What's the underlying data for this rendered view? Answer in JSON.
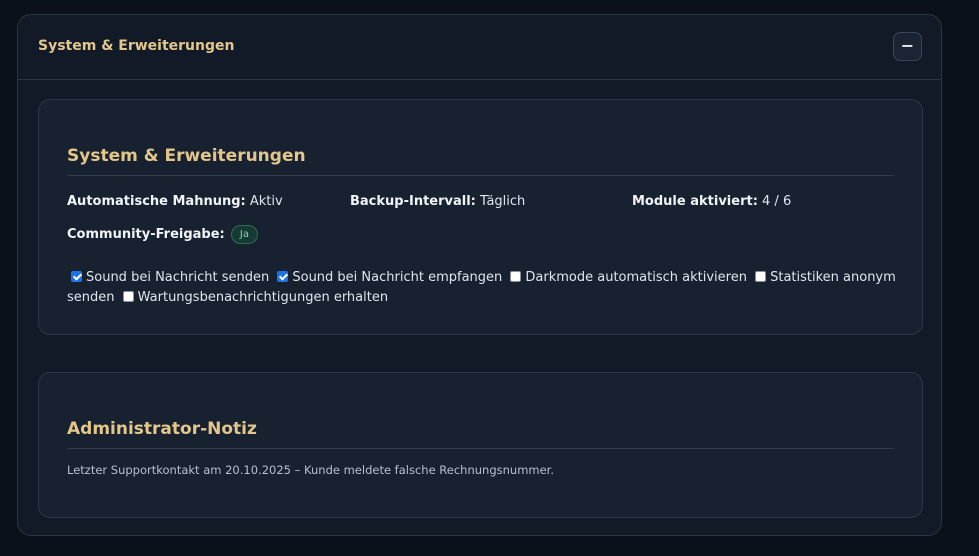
{
  "panel": {
    "title": "System & Erweiterungen",
    "collapse_label": "−"
  },
  "system_card": {
    "title": "System & Erweiterungen",
    "fields": [
      {
        "label": "Automatische Mahnung:",
        "value": "Aktiv"
      },
      {
        "label": "Backup-Intervall:",
        "value": "Täglich"
      },
      {
        "label": "Module aktiviert:",
        "value": "4 / 6"
      }
    ],
    "community": {
      "label": "Community-Freigabe:",
      "badge": "Ja"
    },
    "checkboxes": [
      {
        "label": "Sound bei Nachricht senden",
        "checked": true
      },
      {
        "label": "Sound bei Nachricht empfangen",
        "checked": true
      },
      {
        "label": "Darkmode automatisch aktivieren",
        "checked": false
      },
      {
        "label": "Statistiken anonym senden",
        "checked": false
      },
      {
        "label": "Wartungsbenachrichtigungen erhalten",
        "checked": false
      }
    ]
  },
  "admin_card": {
    "title": "Administrator-Notiz",
    "note": "Letzter Supportkontakt am 20.10.2025 – Kunde meldete falsche Rechnungsnummer."
  },
  "colors": {
    "accent": "#e3c78a",
    "checkbox": "#1a73e8",
    "badge": "#7fd6b4"
  }
}
